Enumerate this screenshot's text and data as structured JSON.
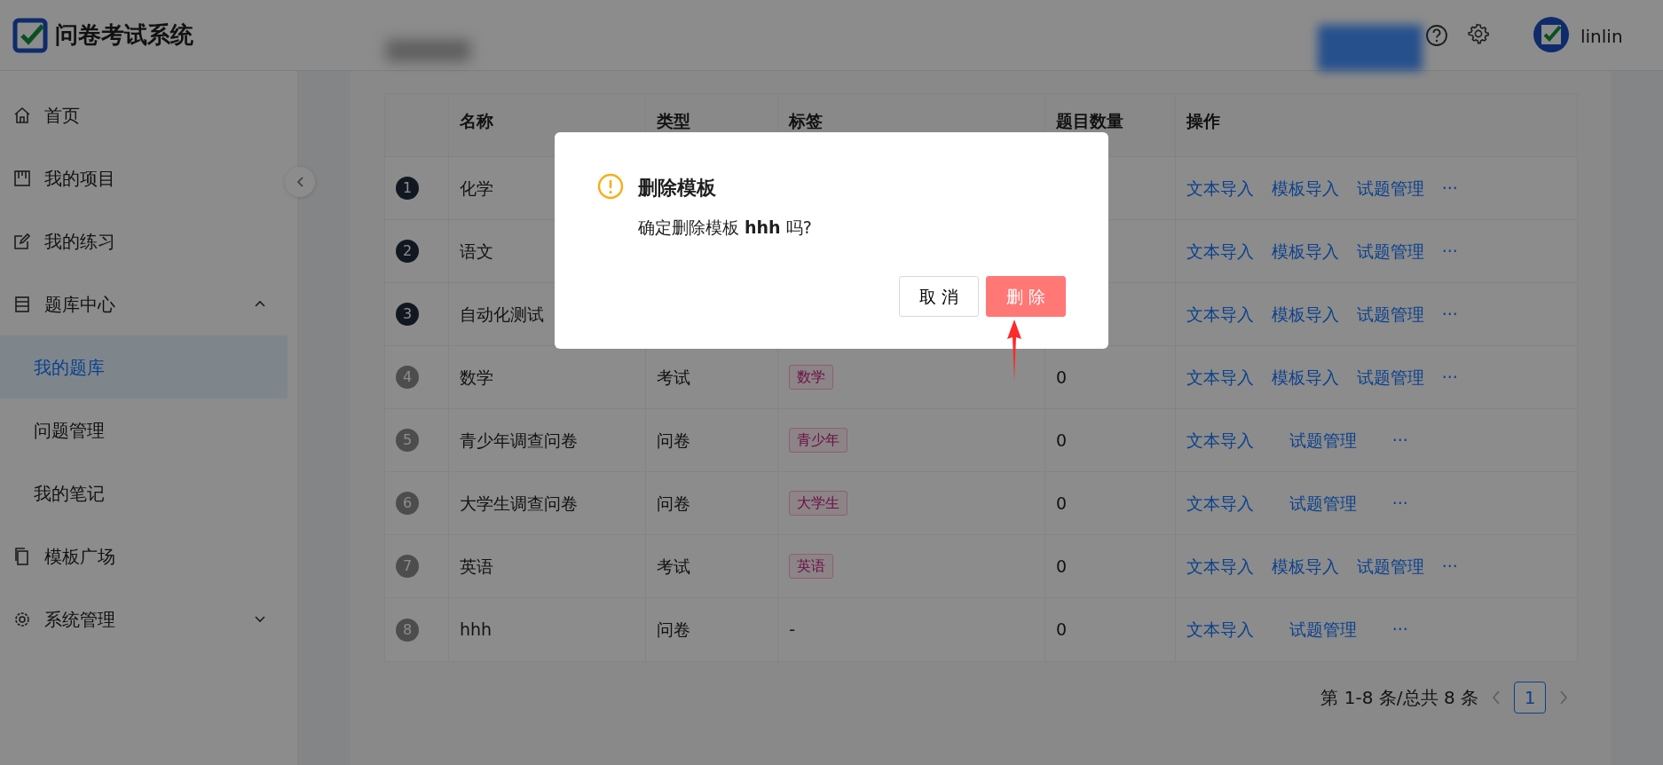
{
  "header": {
    "title": "问卷考试系统",
    "user": "linlin"
  },
  "sidebar": {
    "items": [
      {
        "label": "首页",
        "kind": "home",
        "selected": false
      },
      {
        "label": "我的项目",
        "kind": "board",
        "selected": false
      },
      {
        "label": "我的练习",
        "kind": "edit",
        "selected": false
      },
      {
        "label": "题库中心",
        "kind": "list",
        "selected": false,
        "expanded": true,
        "children": [
          {
            "label": "我的题库",
            "selected": true
          },
          {
            "label": "问题管理",
            "selected": false
          },
          {
            "label": "我的笔记",
            "selected": false
          }
        ]
      },
      {
        "label": "模板广场",
        "kind": "copy",
        "selected": false
      },
      {
        "label": "系统管理",
        "kind": "gear",
        "selected": false,
        "expanded": false
      }
    ]
  },
  "table": {
    "columns": [
      "名称",
      "类型",
      "标签",
      "题目数量",
      "操作"
    ],
    "rows": [
      {
        "index": "1",
        "top": true,
        "name": "化学",
        "actions": [
          "文本导入",
          "模板导入",
          "试题管理",
          "···"
        ]
      },
      {
        "index": "2",
        "top": true,
        "name": "语文",
        "actions": [
          "文本导入",
          "模板导入",
          "试题管理",
          "···"
        ]
      },
      {
        "index": "3",
        "top": true,
        "name": "自动化测试",
        "actions": [
          "文本导入",
          "模板导入",
          "试题管理",
          "···"
        ]
      },
      {
        "index": "4",
        "top": false,
        "name": "数学",
        "type": "考试",
        "tag": "数学",
        "count": "0",
        "actions": [
          "文本导入",
          "模板导入",
          "试题管理",
          "···"
        ]
      },
      {
        "index": "5",
        "top": false,
        "name": "青少年调查问卷",
        "type": "问卷",
        "tag": "青少年",
        "count": "0",
        "actions": [
          "文本导入",
          "试题管理",
          "···"
        ]
      },
      {
        "index": "6",
        "top": false,
        "name": "大学生调查问卷",
        "type": "问卷",
        "tag": "大学生",
        "count": "0",
        "actions": [
          "文本导入",
          "试题管理",
          "···"
        ]
      },
      {
        "index": "7",
        "top": false,
        "name": "英语",
        "type": "考试",
        "tag": "英语",
        "count": "0",
        "actions": [
          "文本导入",
          "模板导入",
          "试题管理",
          "···"
        ]
      },
      {
        "index": "8",
        "top": false,
        "name": "hhh",
        "type": "问卷",
        "tag_text": "-",
        "count": "0",
        "actions": [
          "文本导入",
          "试题管理",
          "···"
        ]
      }
    ]
  },
  "pagination": {
    "summary": "第 1-8 条/总共 8 条",
    "pages": [
      {
        "label": "1",
        "selected": true
      }
    ]
  },
  "dialog": {
    "title": "删除模板",
    "message": "确定删除模板 **hhh** 吗?",
    "buttons": [
      {
        "label": "取 消",
        "kind": "default"
      },
      {
        "label": "删 除",
        "kind": "danger"
      }
    ],
    "annotation": {
      "kind": "arrow"
    }
  }
}
